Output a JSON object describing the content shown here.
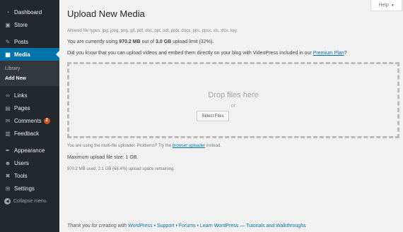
{
  "sidebar": {
    "items": [
      {
        "label": "Dashboard",
        "icon": "dashboard-icon",
        "glyph": "◔"
      },
      {
        "label": "Store",
        "icon": "store-icon",
        "glyph": "▣"
      },
      {
        "label": "Posts",
        "icon": "pin-icon",
        "glyph": "✎"
      },
      {
        "label": "Media",
        "icon": "media-icon",
        "glyph": "▦"
      },
      {
        "label": "Links",
        "icon": "link-icon",
        "glyph": "∞"
      },
      {
        "label": "Pages",
        "icon": "pages-icon",
        "glyph": "▤"
      },
      {
        "label": "Comments",
        "icon": "comment-icon",
        "glyph": "✉",
        "badge": "2"
      },
      {
        "label": "Feedback",
        "icon": "feedback-icon",
        "glyph": "▥"
      },
      {
        "label": "Appearance",
        "icon": "appearance-icon",
        "glyph": "✒"
      },
      {
        "label": "Users",
        "icon": "users-icon",
        "glyph": "☻"
      },
      {
        "label": "Tools",
        "icon": "tools-icon",
        "glyph": "✖"
      },
      {
        "label": "Settings",
        "icon": "settings-icon",
        "glyph": "⊞"
      }
    ],
    "media_submenu": [
      "Library",
      "Add New"
    ],
    "collapse": {
      "label": "Collapse menu",
      "glyph": "◀"
    }
  },
  "help": {
    "label": "Help",
    "glyph": "▼"
  },
  "main": {
    "title": "Upload New Media",
    "allowed_types": "Allowed file types: jpg, jpeg, png, gif, pdf, doc, ppt, odt, pptx, docx, pps, ppsx, xls, xlsx, key.",
    "usage_prefix": "You are currently using ",
    "usage_used": "970.2 MB",
    "usage_mid": " out of ",
    "usage_limit": "3.0 GB",
    "usage_suffix": " upload limit (32%).",
    "videopress_text": "Did you know that you can upload videos and embed them directly on your blog with VideoPress included in our ",
    "videopress_link": "Premium Plan",
    "videopress_end": "?",
    "drop_title": "Drop files here",
    "drop_or": "or",
    "select_button": "Select Files",
    "multi_prefix": "You are using the multi-file uploader. Problems? Try the ",
    "multi_link": "browser uploader",
    "multi_suffix": " instead.",
    "max_upload": "Maximum upload file size: 1 GB.",
    "remaining": "970.2 MB used, 2.1 GB (68.4%) upload space remaining."
  },
  "footer": {
    "thanks": "Thank you for creating with ",
    "wp": "WordPress",
    "sep1": " • ",
    "support": "Support",
    "sep2": " • ",
    "forums": "Forums",
    "sep3": " • ",
    "learn": "Learn WordPress — Tutorials and Walkthroughs"
  },
  "colors": {
    "sidebar": "#23282d",
    "active": "#0073aa",
    "badge": "#d54e21",
    "link": "#0073aa"
  }
}
